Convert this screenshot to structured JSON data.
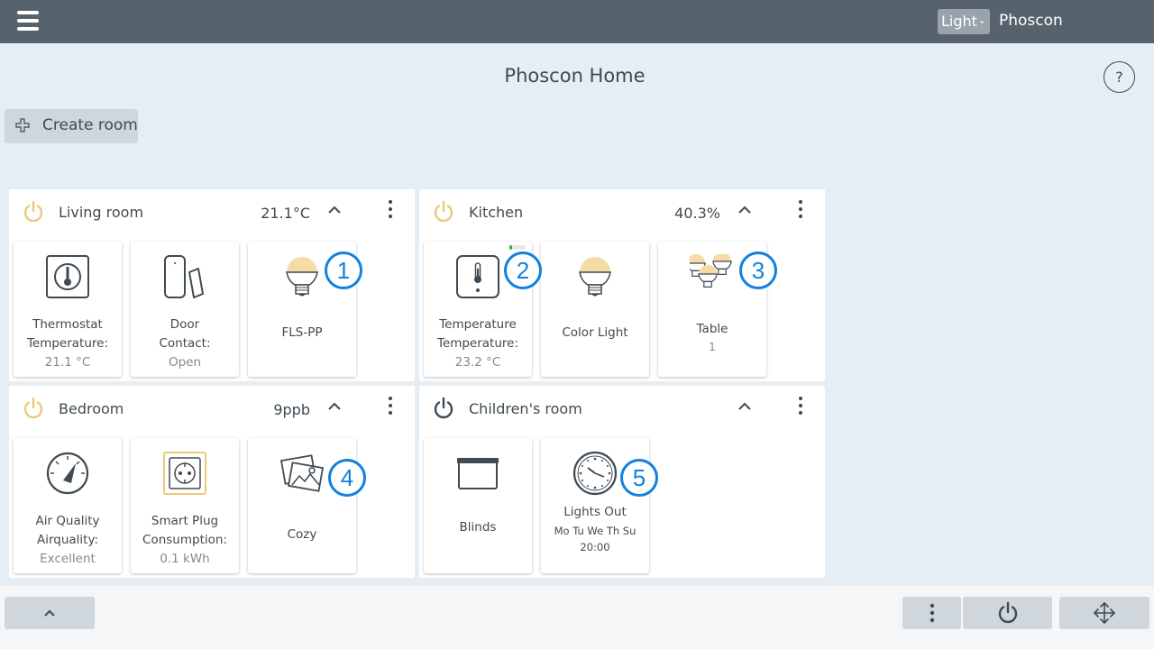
{
  "topbar": {
    "theme_selected": "Light",
    "app_name": "Phoscon"
  },
  "page_title": "Phoscon Home",
  "help_label": "?",
  "create_room_label": "Create room",
  "rooms": [
    {
      "name": "Living room",
      "value": "21.1°C",
      "power_color": "#ecc97a",
      "tiles": [
        {
          "line1": "Thermostat",
          "line2": "Temperature:",
          "line3": "21.1 °C",
          "icon": "thermostat-icon"
        },
        {
          "line1": "Door",
          "line2": "Contact:",
          "line3": "Open",
          "icon": "door-contact-icon"
        },
        {
          "line1": "FLS-PP",
          "icon": "bulb-icon"
        }
      ]
    },
    {
      "name": "Kitchen",
      "value": "40.3%",
      "power_color": "#ecc97a",
      "tiles": [
        {
          "line1": "Temperature",
          "line2": "Temperature:",
          "line3": "23.2 °C",
          "icon": "temperature-sensor-icon"
        },
        {
          "line1": "Color Light",
          "icon": "bulb-icon"
        },
        {
          "line1": "Table",
          "line3": "1",
          "icon": "bulb-group-icon"
        }
      ]
    },
    {
      "name": "Bedroom",
      "value": "9ppb",
      "power_color": "#ecc97a",
      "tiles": [
        {
          "line1": "Air Quality",
          "line2": "Airquality:",
          "line3": "Excellent",
          "icon": "gauge-icon"
        },
        {
          "line1": "Smart Plug",
          "line2": "Consumption:",
          "line3": "0.1 kWh",
          "icon": "smart-plug-icon"
        },
        {
          "line1": "Cozy",
          "icon": "scene-icon"
        }
      ]
    },
    {
      "name": "Children's room",
      "value": "",
      "power_color": "#3f4a52",
      "tiles": [
        {
          "line1": "Blinds",
          "icon": "blinds-icon"
        },
        {
          "line1": "Lights Out",
          "line2": "Mo Tu We Th Su",
          "line3": "20:00",
          "icon": "clock-icon"
        }
      ]
    }
  ],
  "badges": [
    "1",
    "2",
    "3",
    "4",
    "5"
  ],
  "colors": {
    "topbar": "#56626c",
    "background": "#e5eef5",
    "badge": "#1280e0",
    "bulb": "#f5dca6"
  }
}
